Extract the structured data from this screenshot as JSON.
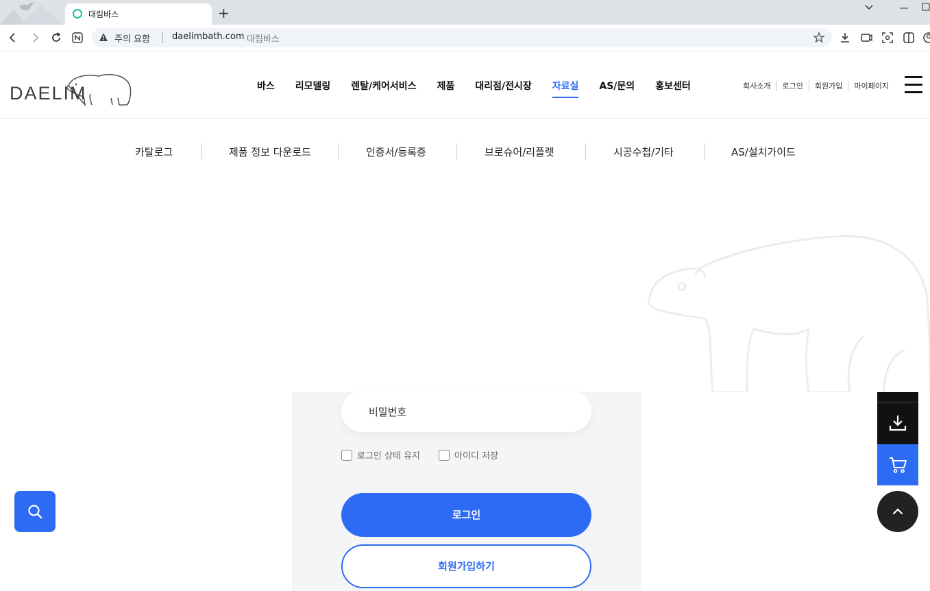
{
  "browser": {
    "tab_title": "대림바스",
    "new_tab": "+",
    "security_warning": "주의 요함",
    "url": "daelimbath.com",
    "url_page_title": "대림바스"
  },
  "header": {
    "logo_text": "DAELIM",
    "nav": [
      "바스",
      "리모델링",
      "렌탈/케어서비스",
      "제품",
      "대리점/전시장",
      "자료실",
      "AS/문의",
      "홍보센터"
    ],
    "active_nav": "자료실",
    "util": [
      "회사소개",
      "로그인",
      "회원가입",
      "마이페이지"
    ]
  },
  "subnav": [
    "카탈로그",
    "제품 정보 다운로드",
    "인증서/등록증",
    "브로슈어/리플렛",
    "시공수첩/기타",
    "AS/설치가이드"
  ],
  "login": {
    "password_placeholder": "비밀번호",
    "keep_login_label": "로그인 상태 유지",
    "save_id_label": "아이디 저장",
    "login_button": "로그인",
    "join_button": "회원가입하기"
  },
  "colors": {
    "accent": "#2e6bf5",
    "dark": "#111111"
  },
  "icons": [
    "search-icon",
    "download-icon",
    "cart-icon",
    "chevron-up-icon",
    "hamburger-icon"
  ]
}
